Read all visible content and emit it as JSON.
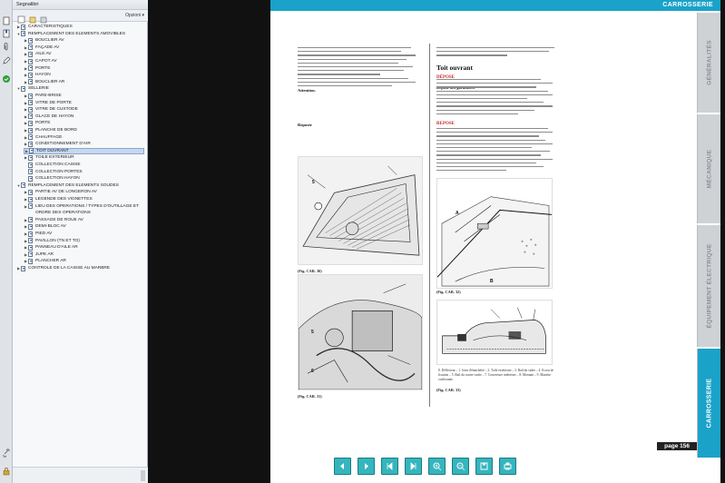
{
  "window": {
    "panel_title": "Segnalibri",
    "options_label": "Opzioni"
  },
  "bookmarks": [
    {
      "label": "CARACTERISTIQUES",
      "level": 0,
      "toggle": "▶"
    },
    {
      "label": "REMPLACEMENT DES ELEMENTS AMOVIBLES",
      "level": 0,
      "toggle": "▼"
    },
    {
      "label": "BOUCLIER AV",
      "level": 1,
      "toggle": "▶"
    },
    {
      "label": "FAÇADE AV",
      "level": 1,
      "toggle": "▶"
    },
    {
      "label": "AILE AV",
      "level": 1,
      "toggle": "▶"
    },
    {
      "label": "CAPOT AV",
      "level": 1,
      "toggle": "▶"
    },
    {
      "label": "PORTE",
      "level": 1,
      "toggle": "▶"
    },
    {
      "label": "HAYON",
      "level": 1,
      "toggle": "▶"
    },
    {
      "label": "BOUCLIER AR",
      "level": 1,
      "toggle": "▶"
    },
    {
      "label": "SELLERIE",
      "level": 0,
      "toggle": "▼"
    },
    {
      "label": "PARE-BRISE",
      "level": 1,
      "toggle": "▶"
    },
    {
      "label": "VITRE DE PORTE",
      "level": 1,
      "toggle": "▶"
    },
    {
      "label": "VITRE DE CUSTODE",
      "level": 1,
      "toggle": "▶"
    },
    {
      "label": "GLACE DE HAYON",
      "level": 1,
      "toggle": "▶"
    },
    {
      "label": "PORTE",
      "level": 1,
      "toggle": "▶"
    },
    {
      "label": "PLANCHE DE BORD",
      "level": 1,
      "toggle": "▶"
    },
    {
      "label": "CHAUFFAGE",
      "level": 1,
      "toggle": "▶"
    },
    {
      "label": "CONDITIONNEMENT D'AIR",
      "level": 1,
      "toggle": "▶"
    },
    {
      "label": "TOIT OUVRANT",
      "level": 1,
      "toggle": "▶",
      "selected": true
    },
    {
      "label": "TOILE EXTERIEUR",
      "level": 1,
      "toggle": "▶"
    },
    {
      "label": "COLLECTION CAISSE",
      "level": 1,
      "toggle": ""
    },
    {
      "label": "COLLECTION PORTES",
      "level": 1,
      "toggle": ""
    },
    {
      "label": "COLLECTION HAYON",
      "level": 1,
      "toggle": ""
    },
    {
      "label": "REMPLACEMENT DES ELEMENTS SOUDES",
      "level": 0,
      "toggle": "▼"
    },
    {
      "label": "PARTIE AV DE LONGERON AV",
      "level": 1,
      "toggle": "▶"
    },
    {
      "label": "LEGENDE DES VIGNETTES",
      "level": 1,
      "toggle": "▶"
    },
    {
      "label": "LIEU DES OPERATIONS / TYPES D'OUTILLAGE ET",
      "level": 1,
      "toggle": "▶"
    },
    {
      "label": "ORDRE DES OPERATIONS",
      "level": 1,
      "toggle": "",
      "cont": true
    },
    {
      "label": "PASSAGE DE ROUE AV",
      "level": 1,
      "toggle": "▶"
    },
    {
      "label": "DEMI-BLOC AV",
      "level": 1,
      "toggle": "▶"
    },
    {
      "label": "PIED AV",
      "level": 1,
      "toggle": "▶"
    },
    {
      "label": "PAVILLON (TN ET TO)",
      "level": 1,
      "toggle": "▶"
    },
    {
      "label": "PANNEAU D'AILE AR",
      "level": 1,
      "toggle": "▶"
    },
    {
      "label": "JUPE AR",
      "level": 1,
      "toggle": "▶"
    },
    {
      "label": "PLANCHER AR",
      "level": 1,
      "toggle": "▶"
    },
    {
      "label": "CONTROLE DE LA CAISSE AU MARBRE",
      "level": 0,
      "toggle": "▶"
    }
  ],
  "page": {
    "header_title": "CARROSSERIE",
    "page_number": "page 156",
    "side_tabs": [
      "GÉNÉRALITÉS",
      "MÉCANIQUE",
      "ÉQUIPEMENT ÉLECTRIQUE",
      "CARROSSERIE"
    ],
    "left_heads": [
      "Attention.",
      "Reposer"
    ],
    "right_heads": [
      "Toit ouvrant",
      "DÉPOSE",
      "Dépose des garnitures",
      "REPOSE"
    ],
    "figure_captions": [
      "(Fig. CAR. 30)",
      "(Fig. CAR. 31)",
      "(Fig. CAR. 32)",
      "(Fig. CAR. 33)"
    ],
    "fig_labels": [
      "5",
      "A",
      "B",
      "5",
      "6"
    ],
    "legend_caption": "8. Déflecteur – 1. Joint d'étanchéité – 2. Toile extérieure – 3. Rail du cadre – 4. Ecrou de fixation – 5. Rail du contre-cadre – 7. Couverture intérieure – 8. Montant – 9. Manette coulissante"
  },
  "nav": [
    "prev-page",
    "next-page",
    "first-page",
    "last-page",
    "zoom-in",
    "zoom-out",
    "save",
    "print"
  ]
}
